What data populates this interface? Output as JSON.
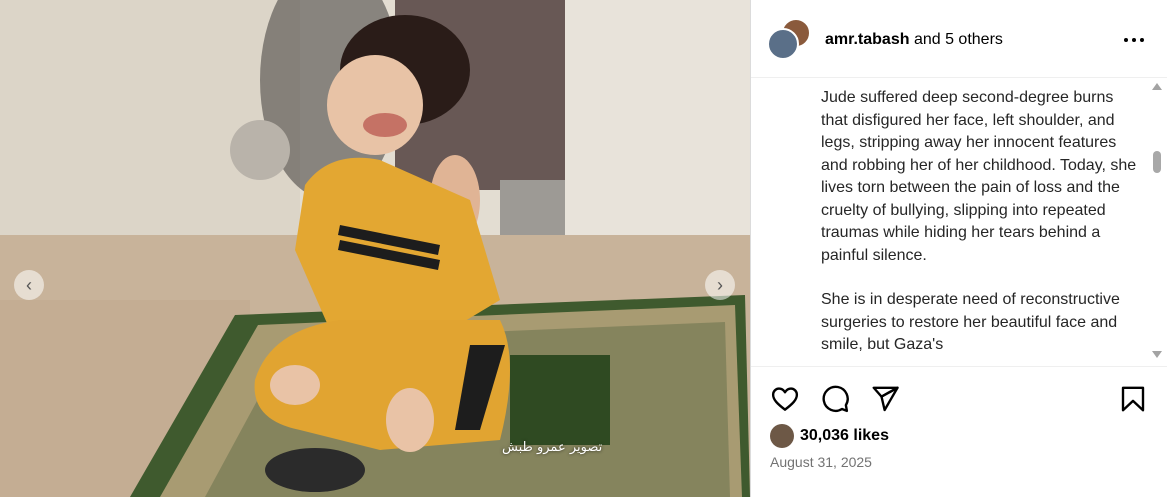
{
  "media": {
    "watermark": "تصوير عمرو طبش",
    "prev_icon": "chevron-left-icon",
    "next_icon": "chevron-right-icon"
  },
  "header": {
    "username": "amr.tabash",
    "coauthors": "and 5 others",
    "more_icon": "more-options-icon"
  },
  "caption": {
    "paragraphs": [
      "Jude suffered deep second-degree burns that disfigured her face, left shoulder, and legs, stripping away her innocent features and robbing her of her childhood. Today, she lives torn between the pain of loss and the cruelty of bullying, slipping into repeated traumas while hiding her tears behind a painful silence.",
      "She is in desperate need of reconstructive surgeries to restore her beautiful face and smile, but Gaza's"
    ]
  },
  "actions": {
    "icons": [
      "heart-icon",
      "comment-icon",
      "share-icon",
      "bookmark-icon"
    ]
  },
  "likes": {
    "text": "30,036 likes"
  },
  "date": {
    "text": "August 31, 2025"
  }
}
